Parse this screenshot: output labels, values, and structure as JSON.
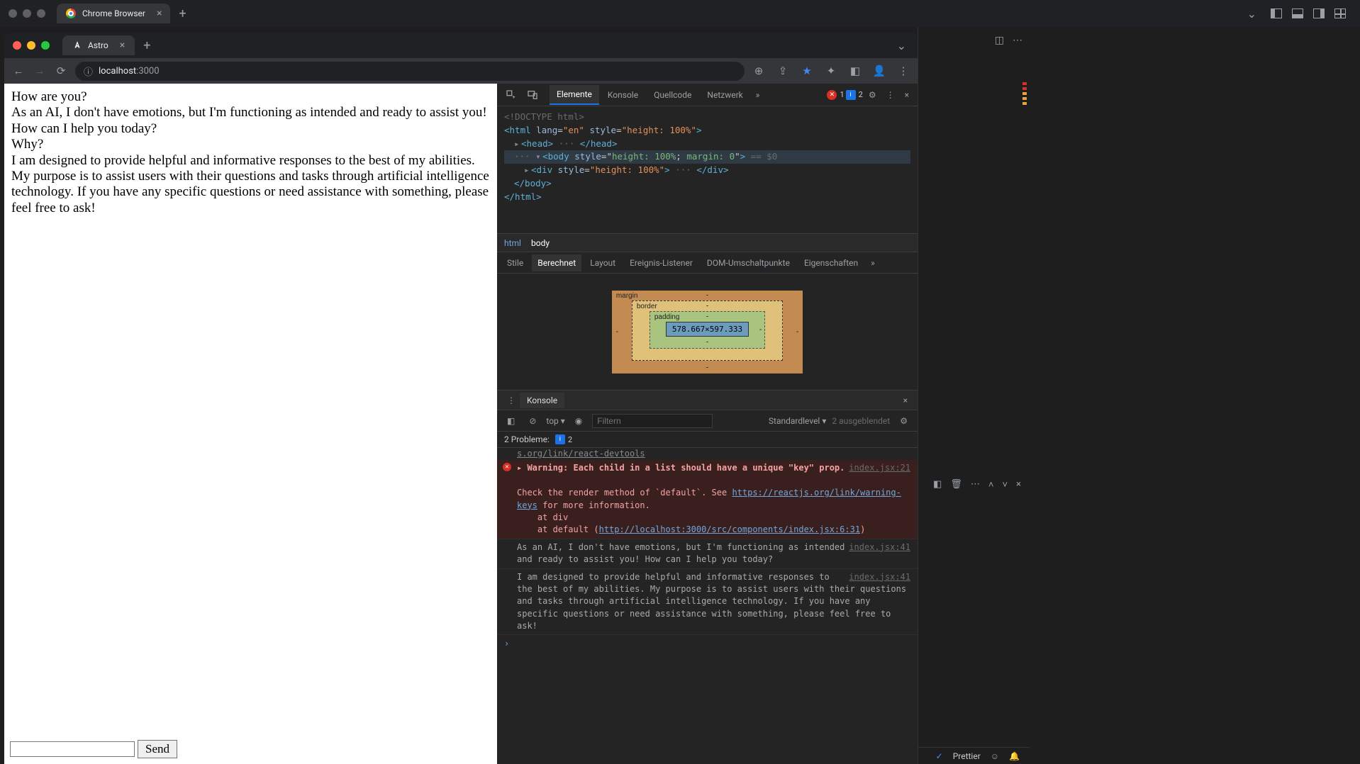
{
  "outer": {
    "tab_title": "Chrome Browser",
    "chevron": "⌄"
  },
  "inner": {
    "tab_title": "Astro",
    "url_host": "localhost",
    "url_path": ":3000"
  },
  "chat": {
    "q1": "How are you?",
    "a1": "As an AI, I don't have emotions, but I'm functioning as intended and ready to assist you! How can I help you today?",
    "q2": "Why?",
    "a2": "I am designed to provide helpful and informative responses to the best of my abilities. My purpose is to assist users with their questions and tasks through artificial intelligence technology. If you have any specific questions or need assistance with something, please feel free to ask!",
    "send_label": "Send",
    "input_value": ""
  },
  "devtools": {
    "tabs": {
      "elements": "Elemente",
      "console": "Konsole",
      "sources": "Quellcode",
      "network": "Netzwerk"
    },
    "err_count": "1",
    "info_count": "2",
    "dom": {
      "doctype": "<!DOCTYPE html>",
      "html_open": "<html lang=\"en\" style=\"height: 100%\">",
      "head": "<head> ··· </head>",
      "body_open": "<body style=\"height: 100%; margin: 0\">",
      "body_eq": " == $0",
      "div": "<div style=\"height: 100%\"> ··· </div>",
      "body_close": "</body>",
      "html_close": "</html>"
    },
    "breadcrumb": {
      "a": "html",
      "b": "body"
    },
    "style_tabs": {
      "stile": "Stile",
      "berechnet": "Berechnet",
      "layout": "Layout",
      "ereignis": "Ereignis-Listener",
      "dom": "DOM-Umschaltpunkte",
      "eigen": "Eigenschaften"
    },
    "boxmodel": {
      "margin": "margin",
      "border": "border",
      "padding": "padding",
      "content": "578.667×597.333"
    },
    "drawer_title": "Konsole",
    "drawer": {
      "top": "top",
      "filter_placeholder": "Filtern",
      "level": "Standardlevel",
      "hidden": "2 ausgeblendet",
      "problems_label": "2 Probleme:",
      "problems_count": "2"
    },
    "logs": {
      "reactdev": "s.org/link/react-devtools",
      "warn_head": "Warning: Each child in a list should have a unique \"key\" prop.",
      "warn_src": "index.jsx:21",
      "warn_body1": "Check the render method of `default`. See ",
      "warn_link1": "https://reactjs.org/link/warning-keys",
      "warn_body2": " for more information.",
      "warn_at1": "    at div",
      "warn_at2": "    at default (",
      "warn_link2": "http://localhost:3000/src/components/index.jsx:6:31",
      "warn_at2_end": ")",
      "log1": "As an AI, I don't have emotions, but I'm functioning as intended and ready to assist you! How can I help you today?",
      "log1_src": "index.jsx:41",
      "log2": "I am designed to provide helpful and informative responses to the best of my abilities. My purpose is to assist users with their questions and tasks through artificial intelligence technology. If you have any specific questions or need assistance with something, please feel free to ask!",
      "log2_src": "index.jsx:41"
    }
  },
  "statusbar": {
    "prettier": "Prettier"
  }
}
